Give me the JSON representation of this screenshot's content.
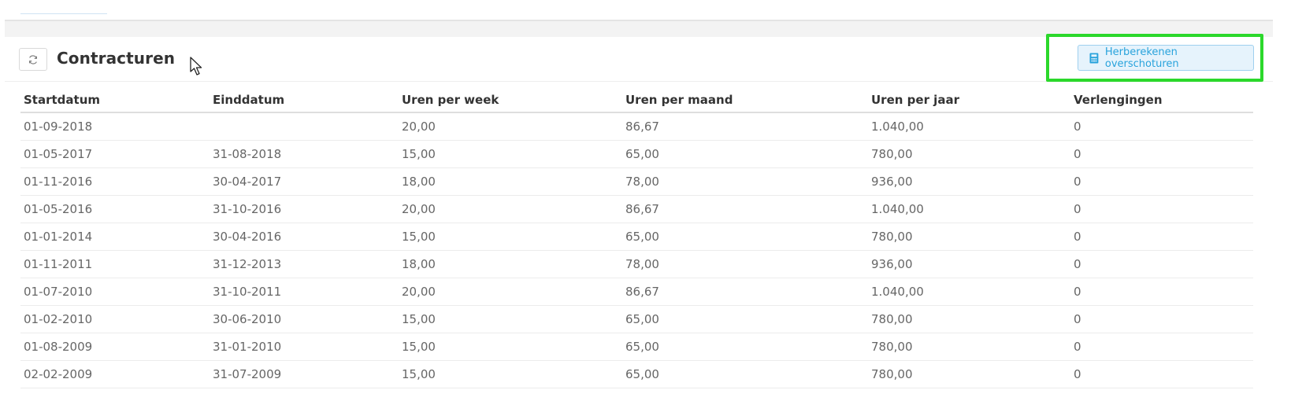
{
  "panel": {
    "title": "Contracturen",
    "refresh_icon": "refresh-icon",
    "recalc_button_label": "Herberekenen overschoturen",
    "recalc_icon": "calculator-icon",
    "highlight_color": "#2bd82b",
    "accent_color": "#29a3dc"
  },
  "table": {
    "columns": [
      "Startdatum",
      "Einddatum",
      "Uren per week",
      "Uren per maand",
      "Uren per jaar",
      "Verlengingen"
    ],
    "rows": [
      [
        "01-09-2018",
        "",
        "20,00",
        "86,67",
        "1.040,00",
        "0"
      ],
      [
        "01-05-2017",
        "31-08-2018",
        "15,00",
        "65,00",
        "780,00",
        "0"
      ],
      [
        "01-11-2016",
        "30-04-2017",
        "18,00",
        "78,00",
        "936,00",
        "0"
      ],
      [
        "01-05-2016",
        "31-10-2016",
        "20,00",
        "86,67",
        "1.040,00",
        "0"
      ],
      [
        "01-01-2014",
        "30-04-2016",
        "15,00",
        "65,00",
        "780,00",
        "0"
      ],
      [
        "01-11-2011",
        "31-12-2013",
        "18,00",
        "78,00",
        "936,00",
        "0"
      ],
      [
        "01-07-2010",
        "31-10-2011",
        "20,00",
        "86,67",
        "1.040,00",
        "0"
      ],
      [
        "01-02-2010",
        "30-06-2010",
        "15,00",
        "65,00",
        "780,00",
        "0"
      ],
      [
        "01-08-2009",
        "31-01-2010",
        "15,00",
        "65,00",
        "780,00",
        "0"
      ],
      [
        "02-02-2009",
        "31-07-2009",
        "15,00",
        "65,00",
        "780,00",
        "0"
      ]
    ]
  }
}
